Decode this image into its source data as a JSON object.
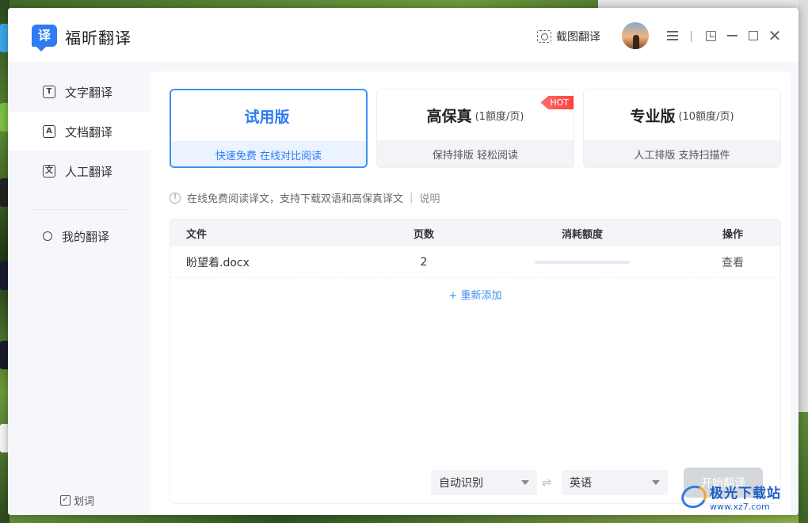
{
  "app": {
    "title": "福昕翻译",
    "logo_char": "译"
  },
  "titlebar": {
    "screenshot_translate": "截图翻译"
  },
  "sidebar": {
    "items": [
      {
        "label": "文字翻译",
        "icon": "text-icon",
        "glyph": "T"
      },
      {
        "label": "文档翻译",
        "icon": "document-icon",
        "glyph": "A"
      },
      {
        "label": "人工翻译",
        "icon": "human-translate-icon",
        "glyph": "文"
      },
      {
        "label": "我的翻译",
        "icon": "user-icon",
        "glyph": ""
      }
    ],
    "active_index": 1,
    "huaci_label": "划词"
  },
  "plans": [
    {
      "name": "试用版",
      "sub": "",
      "desc": "快速免费 在线对比阅读",
      "active": true
    },
    {
      "name": "高保真",
      "sub": "(1额度/页)",
      "desc": "保持排版 轻松阅读",
      "badge": "HOT"
    },
    {
      "name": "专业版",
      "sub": "(10额度/页)",
      "desc": "人工排版 支持扫描件"
    }
  ],
  "notice": {
    "text": "在线免费阅读译文，支持下载双语和高保真译文",
    "sep": "|",
    "link": "说明"
  },
  "table": {
    "headers": [
      "文件",
      "页数",
      "消耗额度",
      "操作"
    ],
    "rows": [
      {
        "file": "盼望着.docx",
        "pages": "2",
        "progress": 1.0,
        "action": "查看"
      }
    ],
    "add_label": "+ 重新添加"
  },
  "controls": {
    "source_lang": "自动识别",
    "target_lang": "英语",
    "swap_glyph": "⇌",
    "start_button": "开始翻译"
  },
  "watermark": {
    "title": "极光下载站",
    "url": "www.xz7.com"
  },
  "colors": {
    "accent": "#2e7bf2",
    "hot": "#ff4d4f",
    "disabled_button": "#d4d7dc"
  }
}
